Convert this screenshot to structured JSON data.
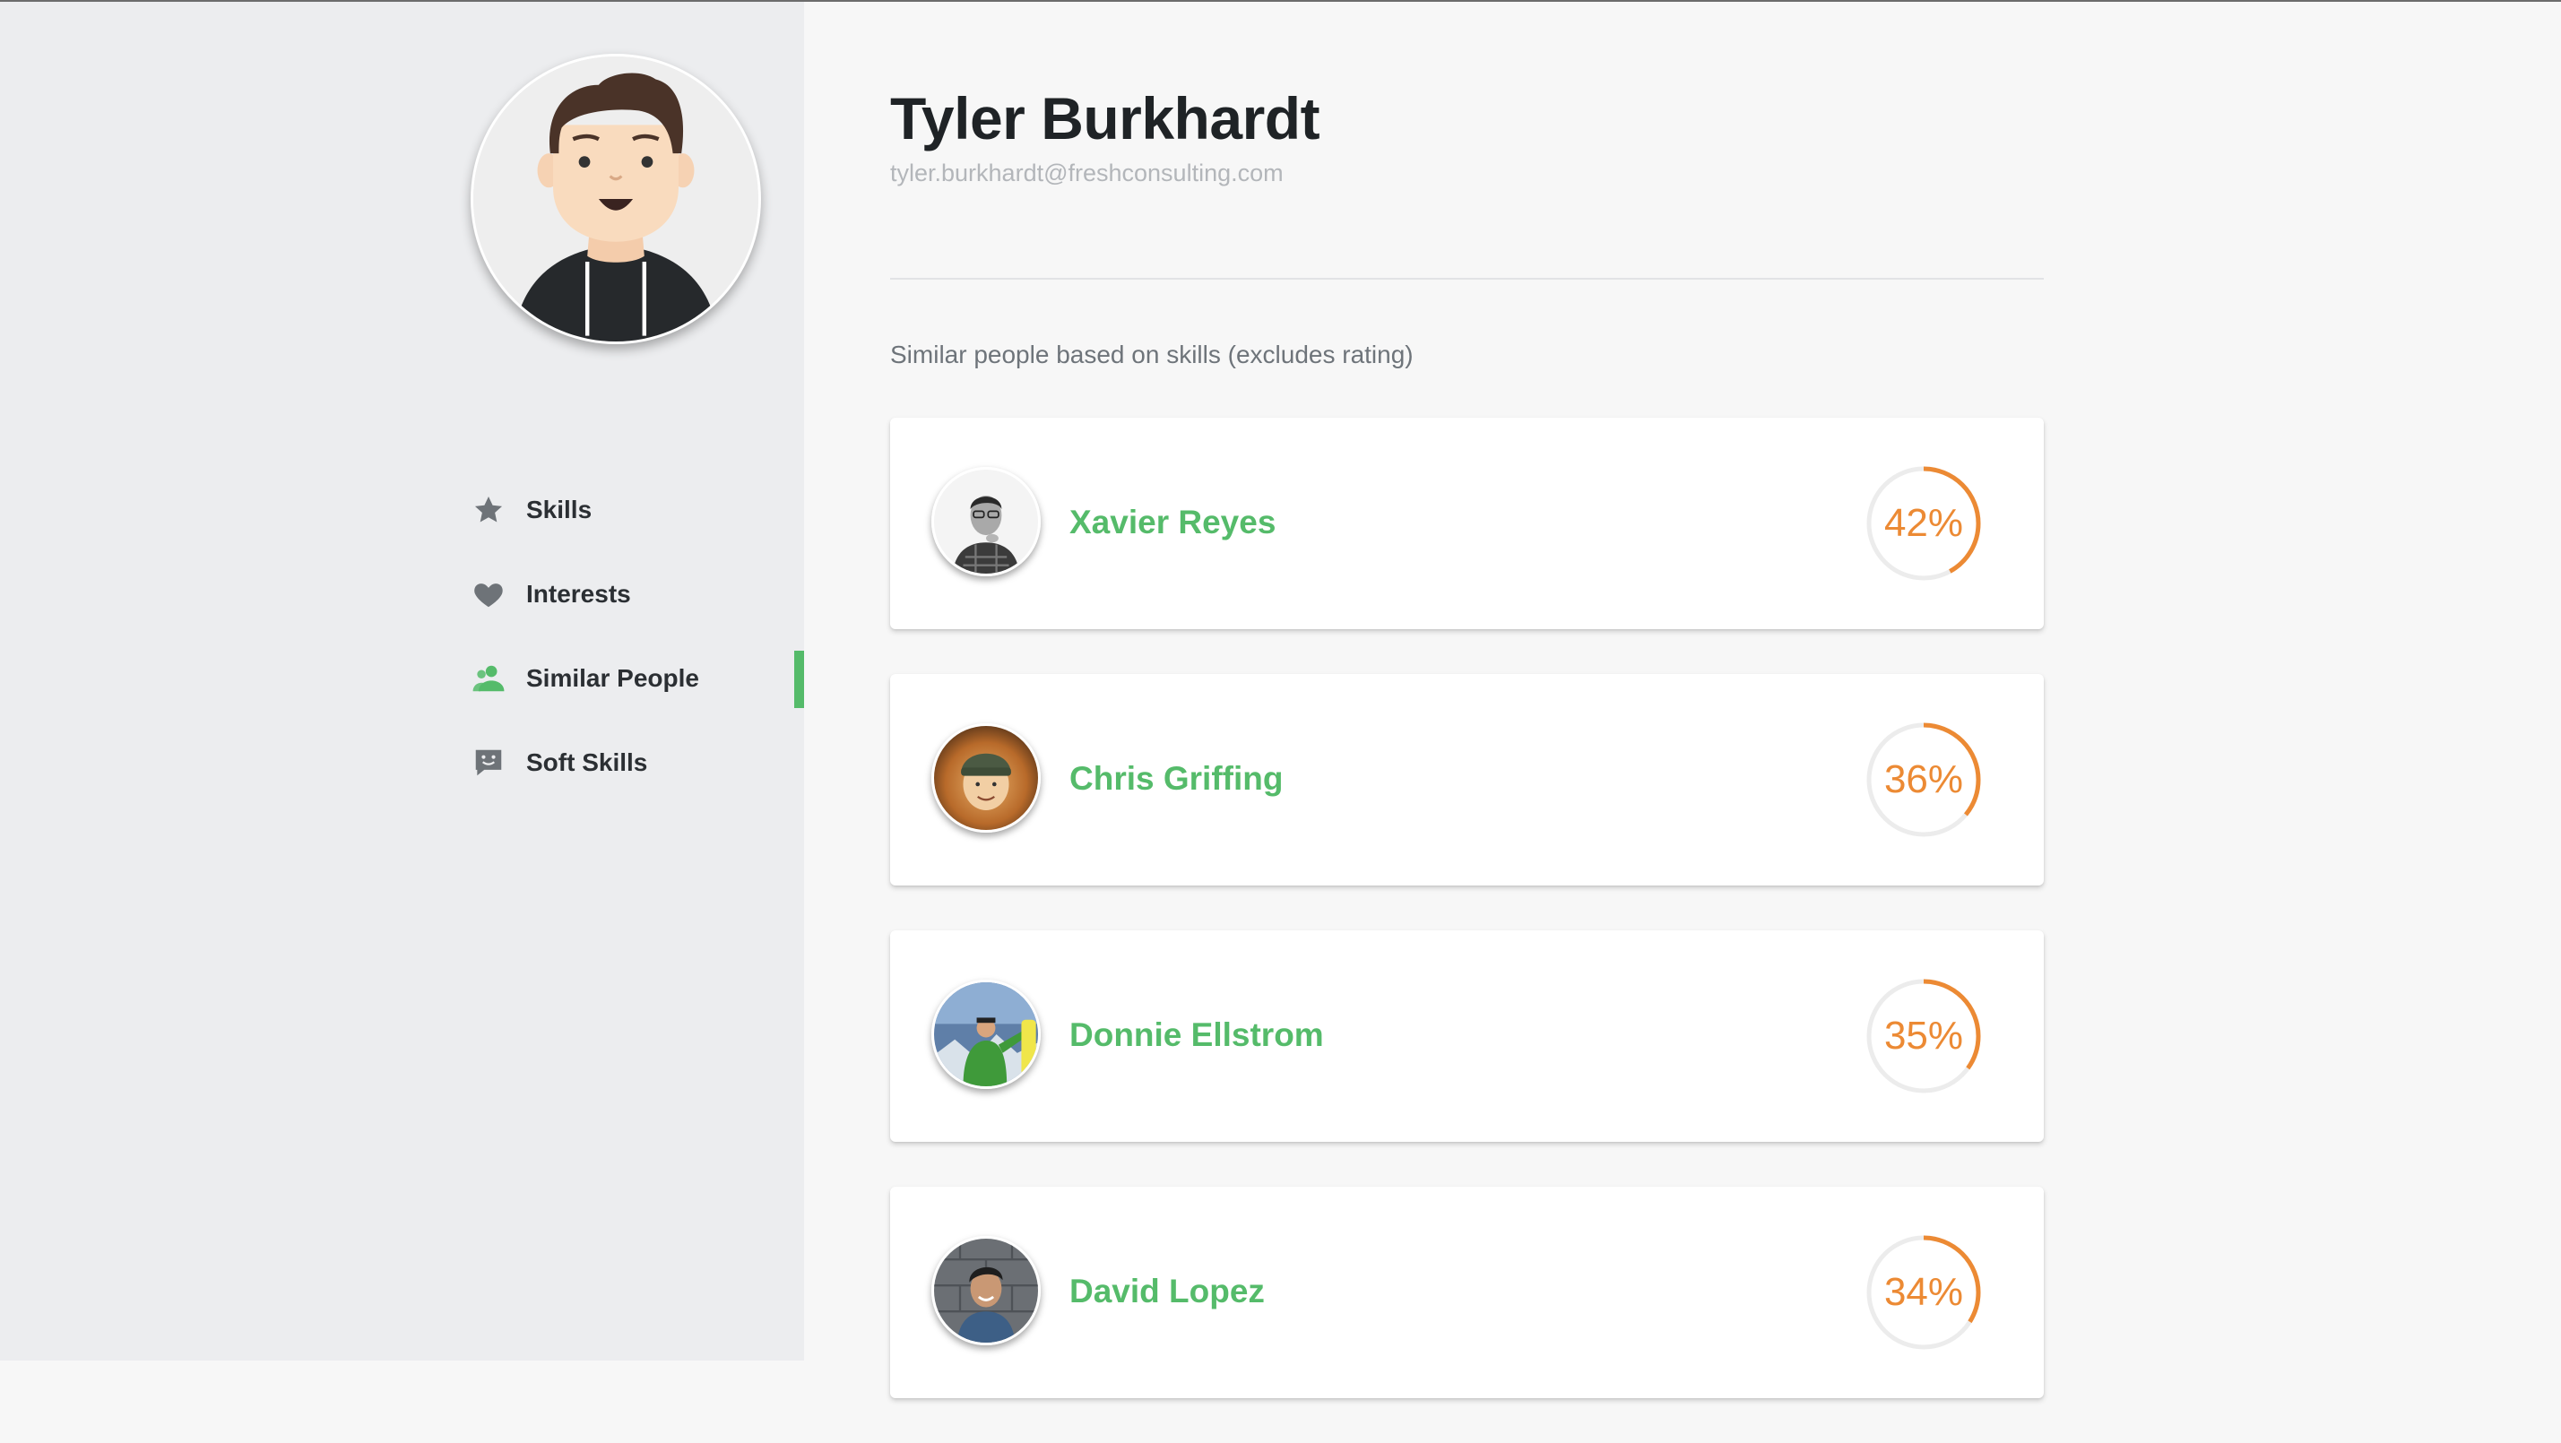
{
  "profile": {
    "name": "Tyler Burkhardt",
    "email": "tyler.burkhardt@freshconsulting.com"
  },
  "nav": {
    "items": [
      {
        "label": "Skills",
        "icon": "star-icon",
        "active": false
      },
      {
        "label": "Interests",
        "icon": "heart-icon",
        "active": false
      },
      {
        "label": "Similar People",
        "icon": "people-icon",
        "active": true
      },
      {
        "label": "Soft Skills",
        "icon": "chat-icon",
        "active": false
      }
    ]
  },
  "similar": {
    "caption": "Similar people based on skills (excludes rating)",
    "people": [
      {
        "name": "Xavier Reyes",
        "percent_label": "42%",
        "percent": 42
      },
      {
        "name": "Chris Griffing",
        "percent_label": "36%",
        "percent": 36
      },
      {
        "name": "Donnie Ellstrom",
        "percent_label": "35%",
        "percent": 35
      },
      {
        "name": "David Lopez",
        "percent_label": "34%",
        "percent": 34
      }
    ]
  },
  "colors": {
    "accent_green": "#55bb6a",
    "accent_orange": "#ec8a34",
    "sidebar_bg": "#ecedef",
    "icon_gray": "#6e7378"
  }
}
